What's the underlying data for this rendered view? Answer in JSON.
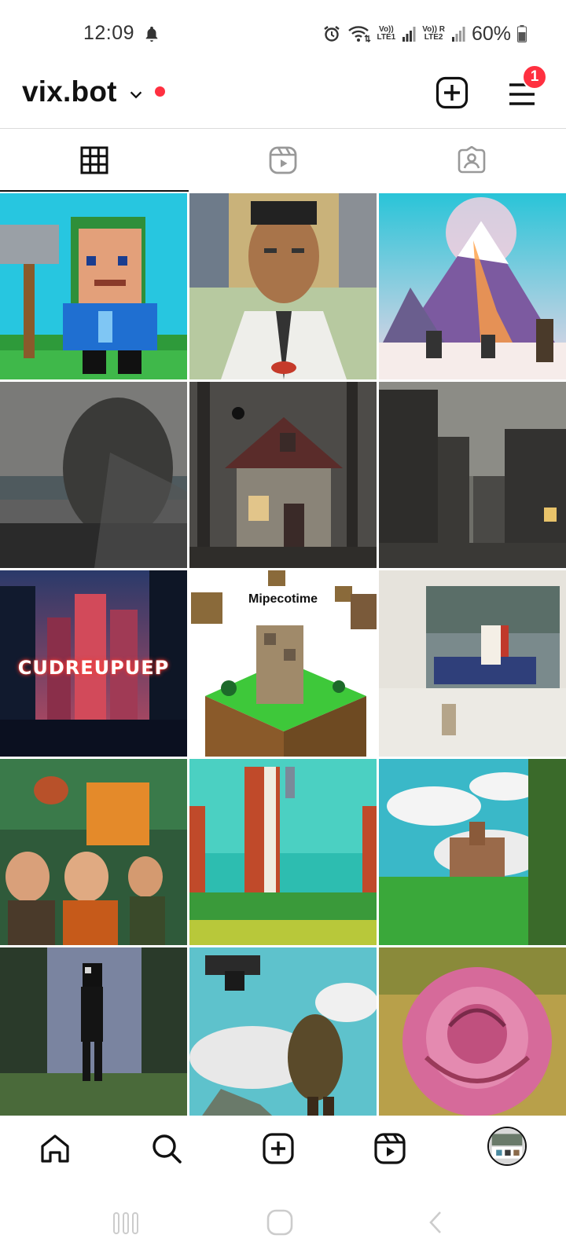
{
  "status_bar": {
    "time": "12:09",
    "battery_percent": "60%",
    "sim1_label_top": "Vo))",
    "sim1_label_bottom": "LTE1",
    "sim2_label_top": "Vo))",
    "sim2_label_bottom": "LTE2",
    "roaming": "R",
    "icons": [
      "bell-icon",
      "alarm-icon",
      "wifi-icon",
      "signal-icon",
      "battery-icon"
    ]
  },
  "header": {
    "username": "vix.bot",
    "notification_badge": "1",
    "icons": [
      "chevron-down-icon",
      "new-post-icon",
      "menu-icon"
    ],
    "accent_color": "#ff3040"
  },
  "tabs": [
    {
      "name": "posts",
      "icon": "grid-icon",
      "selected": true
    },
    {
      "name": "reels",
      "icon": "reels-icon",
      "selected": false
    },
    {
      "name": "tagged",
      "icon": "tagged-icon",
      "selected": false
    }
  ],
  "posts": [
    {
      "caption": ""
    },
    {
      "caption": ""
    },
    {
      "caption": ""
    },
    {
      "caption": ""
    },
    {
      "caption": ""
    },
    {
      "caption": ""
    },
    {
      "caption": "CUDREUPUEP"
    },
    {
      "caption": "Mipecotime"
    },
    {
      "caption": ""
    },
    {
      "caption": ""
    },
    {
      "caption": ""
    },
    {
      "caption": ""
    },
    {
      "caption": ""
    },
    {
      "caption": ""
    },
    {
      "caption": ""
    }
  ],
  "bottom_nav": {
    "items": [
      "home-icon",
      "search-icon",
      "create-icon",
      "reels-icon",
      "profile-avatar"
    ]
  },
  "system_nav": {
    "items": [
      "recent-apps-icon",
      "home-button-icon",
      "back-icon"
    ]
  }
}
